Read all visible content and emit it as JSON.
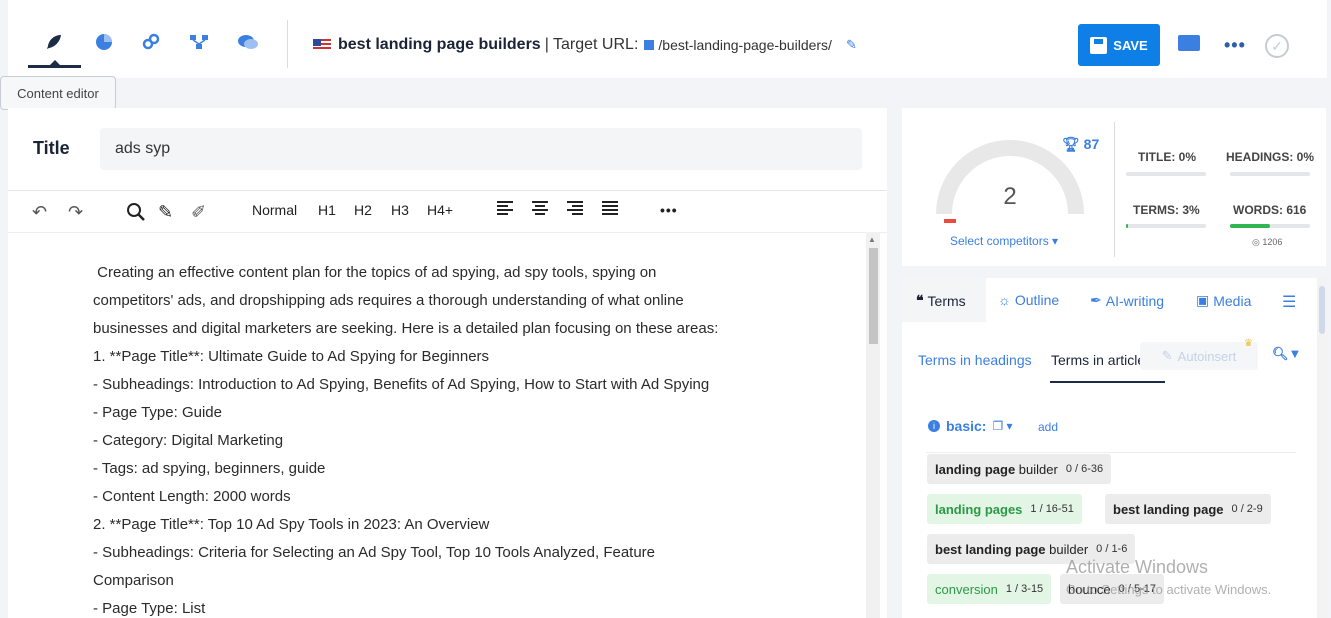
{
  "topbar": {
    "tooltip": "Content editor",
    "keyword": "best landing page builders",
    "target_label": "| Target URL:",
    "target_url": "/best-landing-page-builders/",
    "save_label": "SAVE"
  },
  "editor": {
    "title_label": "Title",
    "title_value": "ads syp",
    "toolbar": {
      "normal": "Normal",
      "h1": "H1",
      "h2": "H2",
      "h3": "H3",
      "h4": "H4+"
    },
    "lines": [
      " Creating an effective content plan for the topics of ad spying, ad spy tools, spying on",
      "competitors' ads, and dropshipping ads requires a thorough understanding of what online",
      "businesses and digital marketers are seeking. Here is a detailed plan focusing on these areas:",
      "1. **Page Title**: Ultimate Guide to Ad Spying for Beginners",
      "- Subheadings: Introduction to Ad Spying, Benefits of Ad Spying, How to Start with Ad Spying",
      "- Page Type: Guide",
      "- Category: Digital Marketing",
      "- Tags: ad spying, beginners, guide",
      "- Content Length: 2000 words",
      "2. **Page Title**: Top 10 Ad Spy Tools in 2023: An Overview",
      "- Subheadings: Criteria for Selecting an Ad Spy Tool, Top 10 Tools Analyzed, Feature",
      "Comparison",
      "- Page Type: List"
    ]
  },
  "score": {
    "trophy_value": "87",
    "gauge_value": "2",
    "gauge_fraction": 0.02,
    "select_competitors": "Select competitors ▾",
    "metrics": {
      "title": {
        "label": "TITLE: 0%",
        "fraction": 0.0
      },
      "headings": {
        "label": "HEADINGS: 0%",
        "fraction": 0.0
      },
      "terms": {
        "label": "TERMS: 3%",
        "fraction": 0.03
      },
      "words": {
        "label": "WORDS: 616",
        "fraction": 0.5
      }
    },
    "words_target": "1206",
    "accent_red": "#e74c3c",
    "accent_green": "#2fb552"
  },
  "terms_panel": {
    "tabs": {
      "terms": "Terms",
      "outline": "Outline",
      "ai_writing": "AI-writing",
      "media": "Media"
    },
    "subtabs": {
      "headings": "Terms in headings",
      "article": "Terms in article"
    },
    "autoinsert": "Autoinsert",
    "basic_label": "basic:",
    "add_label": "add",
    "chips": [
      {
        "term": "landing page",
        "suffix": " builder",
        "count": "0 / 6-36"
      },
      {
        "term": "landing pages",
        "suffix": "",
        "count": "1 / 16-51"
      },
      {
        "term": "best landing page",
        "suffix": "",
        "count": "0 / 2-9"
      },
      {
        "term": "best landing page",
        "suffix": " builder",
        "count": "0 / 1-6"
      },
      {
        "term": "conversion",
        "suffix": "",
        "count": "1 / 3-15"
      },
      {
        "term": "bounce",
        "suffix": "",
        "count": "0 / 5-17"
      }
    ]
  },
  "watermark": {
    "line1": "Activate Windows",
    "line2": "Go to Settings to activate Windows."
  }
}
